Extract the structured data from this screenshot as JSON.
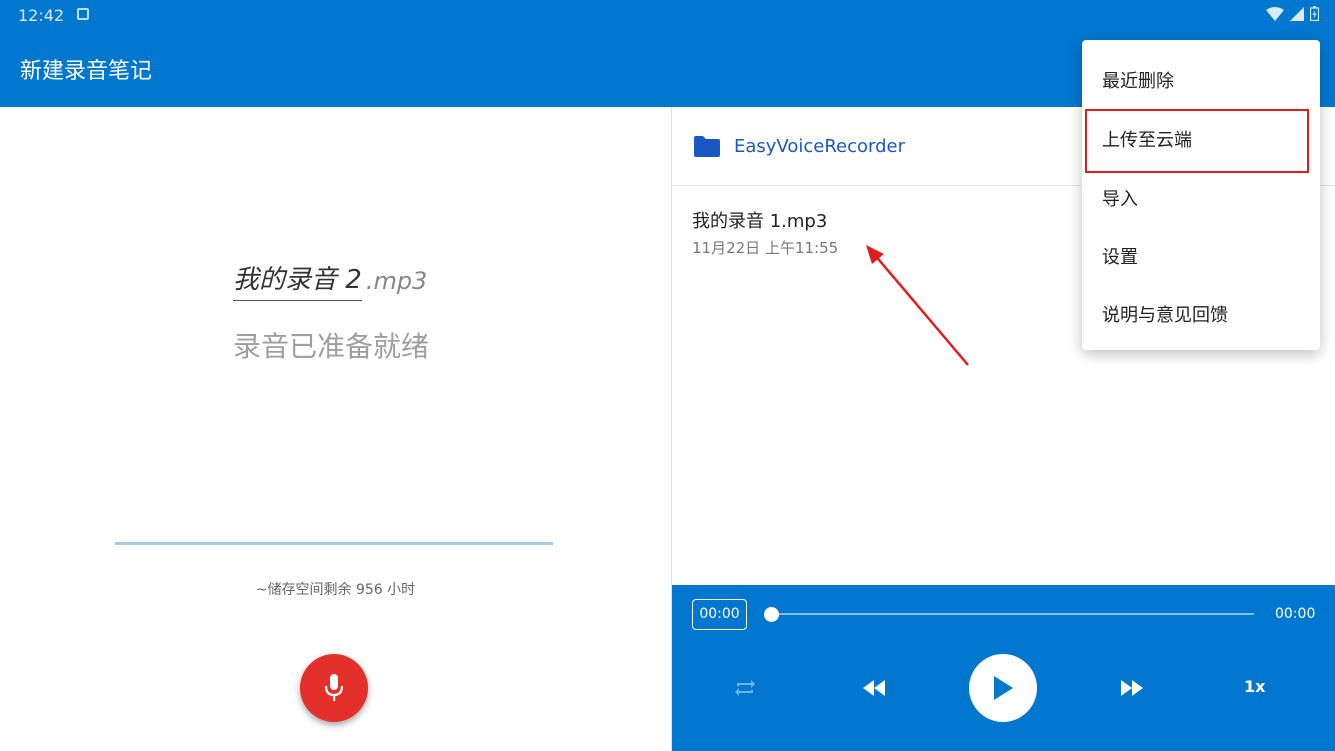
{
  "status_bar": {
    "time": "12:42"
  },
  "app_bar": {
    "title": "新建录音笔记"
  },
  "recorder": {
    "filename": "我的录音 2",
    "extension": ".mp3",
    "status": "录音已准备就绪",
    "storage": "~储存空间剩余 956 小时"
  },
  "browser": {
    "folder": "EasyVoiceRecorder",
    "files": [
      {
        "name": "我的录音 1.mp3",
        "date": "11月22日 上午11:55"
      }
    ]
  },
  "player": {
    "current_time": "00:00",
    "total_time": "00:00",
    "progress": 0,
    "speed": "1x"
  },
  "menu": {
    "items": [
      {
        "label": "最近删除"
      },
      {
        "label": "上传至云端"
      },
      {
        "label": "导入"
      },
      {
        "label": "设置"
      },
      {
        "label": "说明与意见回馈"
      }
    ]
  },
  "colors": {
    "primary": "#0277cf",
    "record": "#e4302b",
    "folder": "#1a57c5",
    "annotation": "#e21b1b"
  }
}
